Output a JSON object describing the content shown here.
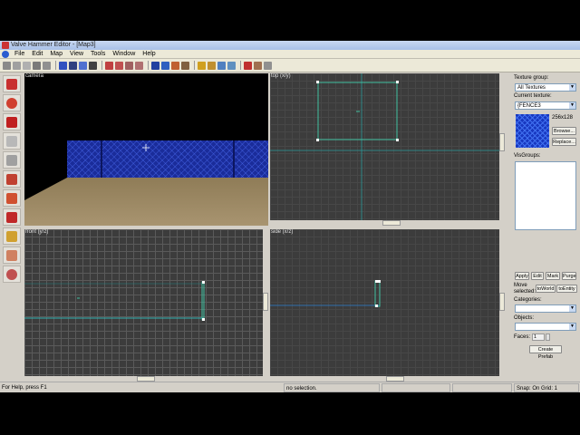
{
  "window": {
    "title": "Valve Hammer Editor - [Map3]"
  },
  "menu": [
    "File",
    "Edit",
    "Map",
    "View",
    "Tools",
    "Window",
    "Help"
  ],
  "viewports": {
    "camera": "camera",
    "top": "top (x/y)",
    "front": "front (y/z)",
    "side": "side (x/z)"
  },
  "texture_panel": {
    "group_label": "Texture group:",
    "group_value": "All Textures",
    "current_label": "Current texture:",
    "current_value": "{FENCE3",
    "size": "256x128",
    "browse": "Browse...",
    "replace": "Replace...",
    "visgroups_label": "VisGroups:",
    "buttons": [
      "Apply",
      "Edit",
      "Mark",
      "Purge"
    ]
  },
  "move_selected": {
    "label1": "Move",
    "label2": "selected:",
    "to_world": "toWorld",
    "to_entity": "toEntity"
  },
  "prefab": {
    "categories_label": "Categories:",
    "objects_label": "Objects:",
    "faces_label": "Faces:",
    "faces_value": "1",
    "create": "Create Prefab"
  },
  "status": {
    "help": "For Help, press F1",
    "selection": "no selection.",
    "snap": "Snap: On Grid: 1"
  },
  "colors": {
    "brush_outline": "#40c0a0",
    "fence": "#1a2c9a",
    "floor": "#9c8760"
  }
}
